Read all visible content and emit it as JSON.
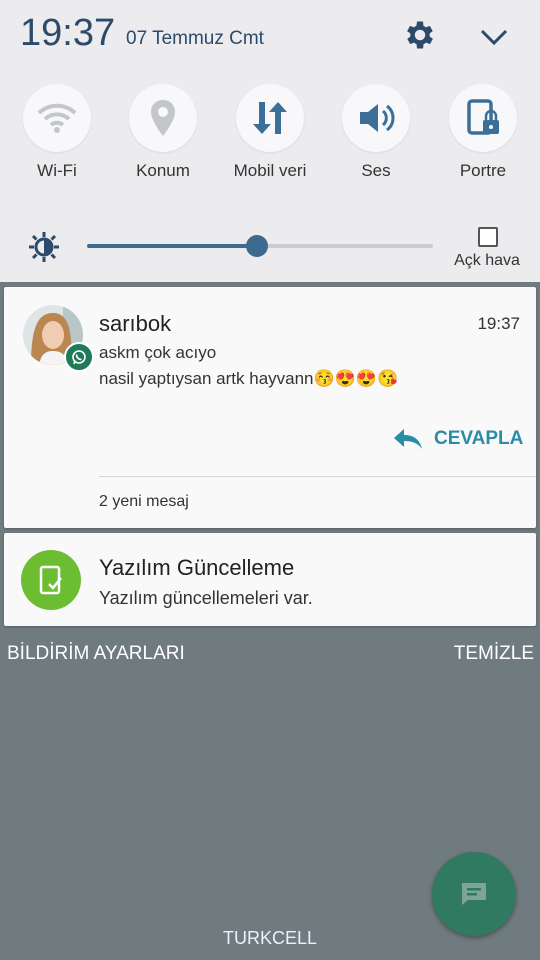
{
  "status": {
    "time": "19:37",
    "date": "07 Temmuz Cmt"
  },
  "tiles": [
    {
      "label": "Wi-Fi",
      "icon": "wifi-icon"
    },
    {
      "label": "Konum",
      "icon": "location-icon"
    },
    {
      "label": "Mobil veri",
      "icon": "mobile-data-icon"
    },
    {
      "label": "Ses",
      "icon": "sound-icon"
    },
    {
      "label": "Portre",
      "icon": "portrait-lock-icon"
    }
  ],
  "brightness": {
    "level": 0.49,
    "auto_label": "Açk hava",
    "auto_checked": false
  },
  "notifications": {
    "whatsapp": {
      "sender": "sarıbok",
      "time": "19:37",
      "line1": "askm çok acıyo",
      "line2": "nasil yaptıysan artk hayvann😚😍😍😘",
      "reply_label": "CEVAPLA",
      "summary": "2 yeni mesaj"
    },
    "update": {
      "title": "Yazılım Güncelleme",
      "text": "Yazılım güncellemeleri var."
    }
  },
  "footer": {
    "settings_label": "BİLDİRİM AYARLARI",
    "clear_label": "TEMİZLE"
  },
  "carrier": "TURKCELL",
  "colors": {
    "accent": "#3d6a8f",
    "reply": "#2b8ca6",
    "update_green": "#6dbd33",
    "whatsapp_green": "#1f7a5a",
    "fab": "#2f7a60"
  }
}
